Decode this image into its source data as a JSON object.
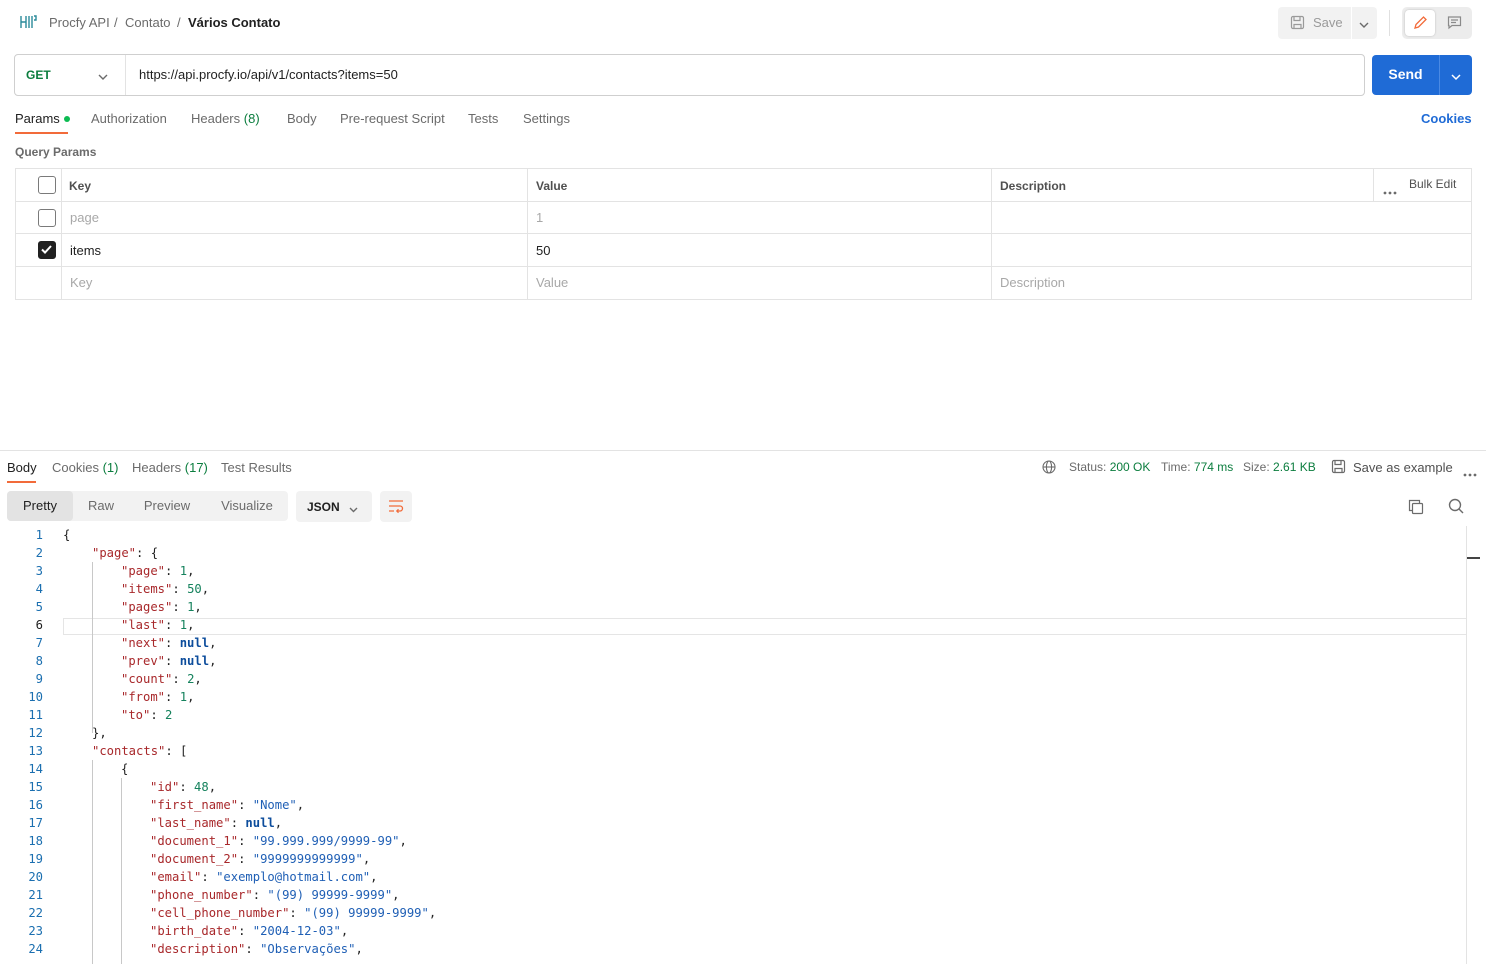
{
  "breadcrumb": {
    "collection": "Procfy API",
    "folder": "Contato",
    "request": "Vários Contato",
    "separator": "/"
  },
  "header": {
    "save_label": "Save"
  },
  "request": {
    "method": "GET",
    "url": "https://api.procfy.io/api/v1/contacts?items=50",
    "send_label": "Send"
  },
  "request_tabs": [
    {
      "label": "Params",
      "active": true,
      "count": ""
    },
    {
      "label": "Authorization",
      "active": false,
      "count": ""
    },
    {
      "label": "Headers",
      "active": false,
      "count": "(8)"
    },
    {
      "label": "Body",
      "active": false,
      "count": ""
    },
    {
      "label": "Pre-request Script",
      "active": false,
      "count": ""
    },
    {
      "label": "Tests",
      "active": false,
      "count": ""
    },
    {
      "label": "Settings",
      "active": false,
      "count": ""
    }
  ],
  "cookies_link": "Cookies",
  "query_params": {
    "title": "Query Params",
    "headers": {
      "key": "Key",
      "value": "Value",
      "description": "Description",
      "bulk_edit": "Bulk Edit"
    },
    "rows": [
      {
        "checked": false,
        "key": "page",
        "value": "1",
        "description": ""
      },
      {
        "checked": true,
        "key": "items",
        "value": "50",
        "description": ""
      }
    ],
    "placeholders": {
      "key": "Key",
      "value": "Value",
      "description": "Description"
    }
  },
  "response_tabs": [
    {
      "label": "Body",
      "active": true,
      "count": ""
    },
    {
      "label": "Cookies",
      "active": false,
      "count": "(1)"
    },
    {
      "label": "Headers",
      "active": false,
      "count": "(17)"
    },
    {
      "label": "Test Results",
      "active": false,
      "count": ""
    }
  ],
  "response_meta": {
    "status_label": "Status:",
    "status_value": "200 OK",
    "time_label": "Time:",
    "time_value": "774 ms",
    "size_label": "Size:",
    "size_value": "2.61 KB",
    "save_example": "Save as example"
  },
  "view_modes": [
    "Pretty",
    "Raw",
    "Preview",
    "Visualize"
  ],
  "format": "JSON",
  "code_lines": [
    {
      "n": "1",
      "indent": 0,
      "tokens": [
        [
          "p",
          "{"
        ]
      ]
    },
    {
      "n": "2",
      "indent": 1,
      "tokens": [
        [
          "k",
          "\"page\""
        ],
        [
          "p",
          ": {"
        ]
      ]
    },
    {
      "n": "3",
      "indent": 2,
      "tokens": [
        [
          "k",
          "\"page\""
        ],
        [
          "p",
          ": "
        ],
        [
          "n",
          "1"
        ],
        [
          "p",
          ","
        ]
      ]
    },
    {
      "n": "4",
      "indent": 2,
      "tokens": [
        [
          "k",
          "\"items\""
        ],
        [
          "p",
          ": "
        ],
        [
          "n",
          "50"
        ],
        [
          "p",
          ","
        ]
      ]
    },
    {
      "n": "5",
      "indent": 2,
      "tokens": [
        [
          "k",
          "\"pages\""
        ],
        [
          "p",
          ": "
        ],
        [
          "n",
          "1"
        ],
        [
          "p",
          ","
        ]
      ]
    },
    {
      "n": "6",
      "indent": 2,
      "tokens": [
        [
          "k",
          "\"last\""
        ],
        [
          "p",
          ": "
        ],
        [
          "n",
          "1"
        ],
        [
          "p",
          ","
        ]
      ]
    },
    {
      "n": "7",
      "indent": 2,
      "tokens": [
        [
          "k",
          "\"next\""
        ],
        [
          "p",
          ": "
        ],
        [
          "nl",
          "null"
        ],
        [
          "p",
          ","
        ]
      ]
    },
    {
      "n": "8",
      "indent": 2,
      "tokens": [
        [
          "k",
          "\"prev\""
        ],
        [
          "p",
          ": "
        ],
        [
          "nl",
          "null"
        ],
        [
          "p",
          ","
        ]
      ]
    },
    {
      "n": "9",
      "indent": 2,
      "tokens": [
        [
          "k",
          "\"count\""
        ],
        [
          "p",
          ": "
        ],
        [
          "n",
          "2"
        ],
        [
          "p",
          ","
        ]
      ]
    },
    {
      "n": "10",
      "indent": 2,
      "tokens": [
        [
          "k",
          "\"from\""
        ],
        [
          "p",
          ": "
        ],
        [
          "n",
          "1"
        ],
        [
          "p",
          ","
        ]
      ]
    },
    {
      "n": "11",
      "indent": 2,
      "tokens": [
        [
          "k",
          "\"to\""
        ],
        [
          "p",
          ": "
        ],
        [
          "n",
          "2"
        ]
      ]
    },
    {
      "n": "12",
      "indent": 1,
      "tokens": [
        [
          "p",
          "},"
        ]
      ]
    },
    {
      "n": "13",
      "indent": 1,
      "tokens": [
        [
          "k",
          "\"contacts\""
        ],
        [
          "p",
          ": ["
        ]
      ]
    },
    {
      "n": "14",
      "indent": 2,
      "tokens": [
        [
          "p",
          "{"
        ]
      ]
    },
    {
      "n": "15",
      "indent": 3,
      "tokens": [
        [
          "k",
          "\"id\""
        ],
        [
          "p",
          ": "
        ],
        [
          "n",
          "48"
        ],
        [
          "p",
          ","
        ]
      ]
    },
    {
      "n": "16",
      "indent": 3,
      "tokens": [
        [
          "k",
          "\"first_name\""
        ],
        [
          "p",
          ": "
        ],
        [
          "s",
          "\"Nome\""
        ],
        [
          "p",
          ","
        ]
      ]
    },
    {
      "n": "17",
      "indent": 3,
      "tokens": [
        [
          "k",
          "\"last_name\""
        ],
        [
          "p",
          ": "
        ],
        [
          "nl",
          "null"
        ],
        [
          "p",
          ","
        ]
      ]
    },
    {
      "n": "18",
      "indent": 3,
      "tokens": [
        [
          "k",
          "\"document_1\""
        ],
        [
          "p",
          ": "
        ],
        [
          "s",
          "\"99.999.999/9999-99\""
        ],
        [
          "p",
          ","
        ]
      ]
    },
    {
      "n": "19",
      "indent": 3,
      "tokens": [
        [
          "k",
          "\"document_2\""
        ],
        [
          "p",
          ": "
        ],
        [
          "s",
          "\"9999999999999\""
        ],
        [
          "p",
          ","
        ]
      ]
    },
    {
      "n": "20",
      "indent": 3,
      "tokens": [
        [
          "k",
          "\"email\""
        ],
        [
          "p",
          ": "
        ],
        [
          "s",
          "\"exemplo@hotmail.com\""
        ],
        [
          "p",
          ","
        ]
      ]
    },
    {
      "n": "21",
      "indent": 3,
      "tokens": [
        [
          "k",
          "\"phone_number\""
        ],
        [
          "p",
          ": "
        ],
        [
          "s",
          "\"(99) 99999-9999\""
        ],
        [
          "p",
          ","
        ]
      ]
    },
    {
      "n": "22",
      "indent": 3,
      "tokens": [
        [
          "k",
          "\"cell_phone_number\""
        ],
        [
          "p",
          ": "
        ],
        [
          "s",
          "\"(99) 99999-9999\""
        ],
        [
          "p",
          ","
        ]
      ]
    },
    {
      "n": "23",
      "indent": 3,
      "tokens": [
        [
          "k",
          "\"birth_date\""
        ],
        [
          "p",
          ": "
        ],
        [
          "s",
          "\"2004-12-03\""
        ],
        [
          "p",
          ","
        ]
      ]
    },
    {
      "n": "24",
      "indent": 3,
      "tokens": [
        [
          "k",
          "\"description\""
        ],
        [
          "p",
          ": "
        ],
        [
          "s",
          "\"Observações\""
        ],
        [
          "p",
          ","
        ]
      ]
    }
  ],
  "current_line": "6",
  "colors": {
    "accent": "#f26b3a",
    "send": "#1f6bd6",
    "method_get": "#0b7d3e",
    "status_ok": "#0b7d3e",
    "json_key": "#a8282b",
    "json_string": "#1f5fb5",
    "json_number": "#15825d"
  },
  "icons": [
    "http-icon",
    "save-icon",
    "chevron-down-icon",
    "edit-icon",
    "comment-icon",
    "more-icon",
    "globe-icon",
    "copy-icon",
    "search-icon",
    "wrap-icon"
  ]
}
